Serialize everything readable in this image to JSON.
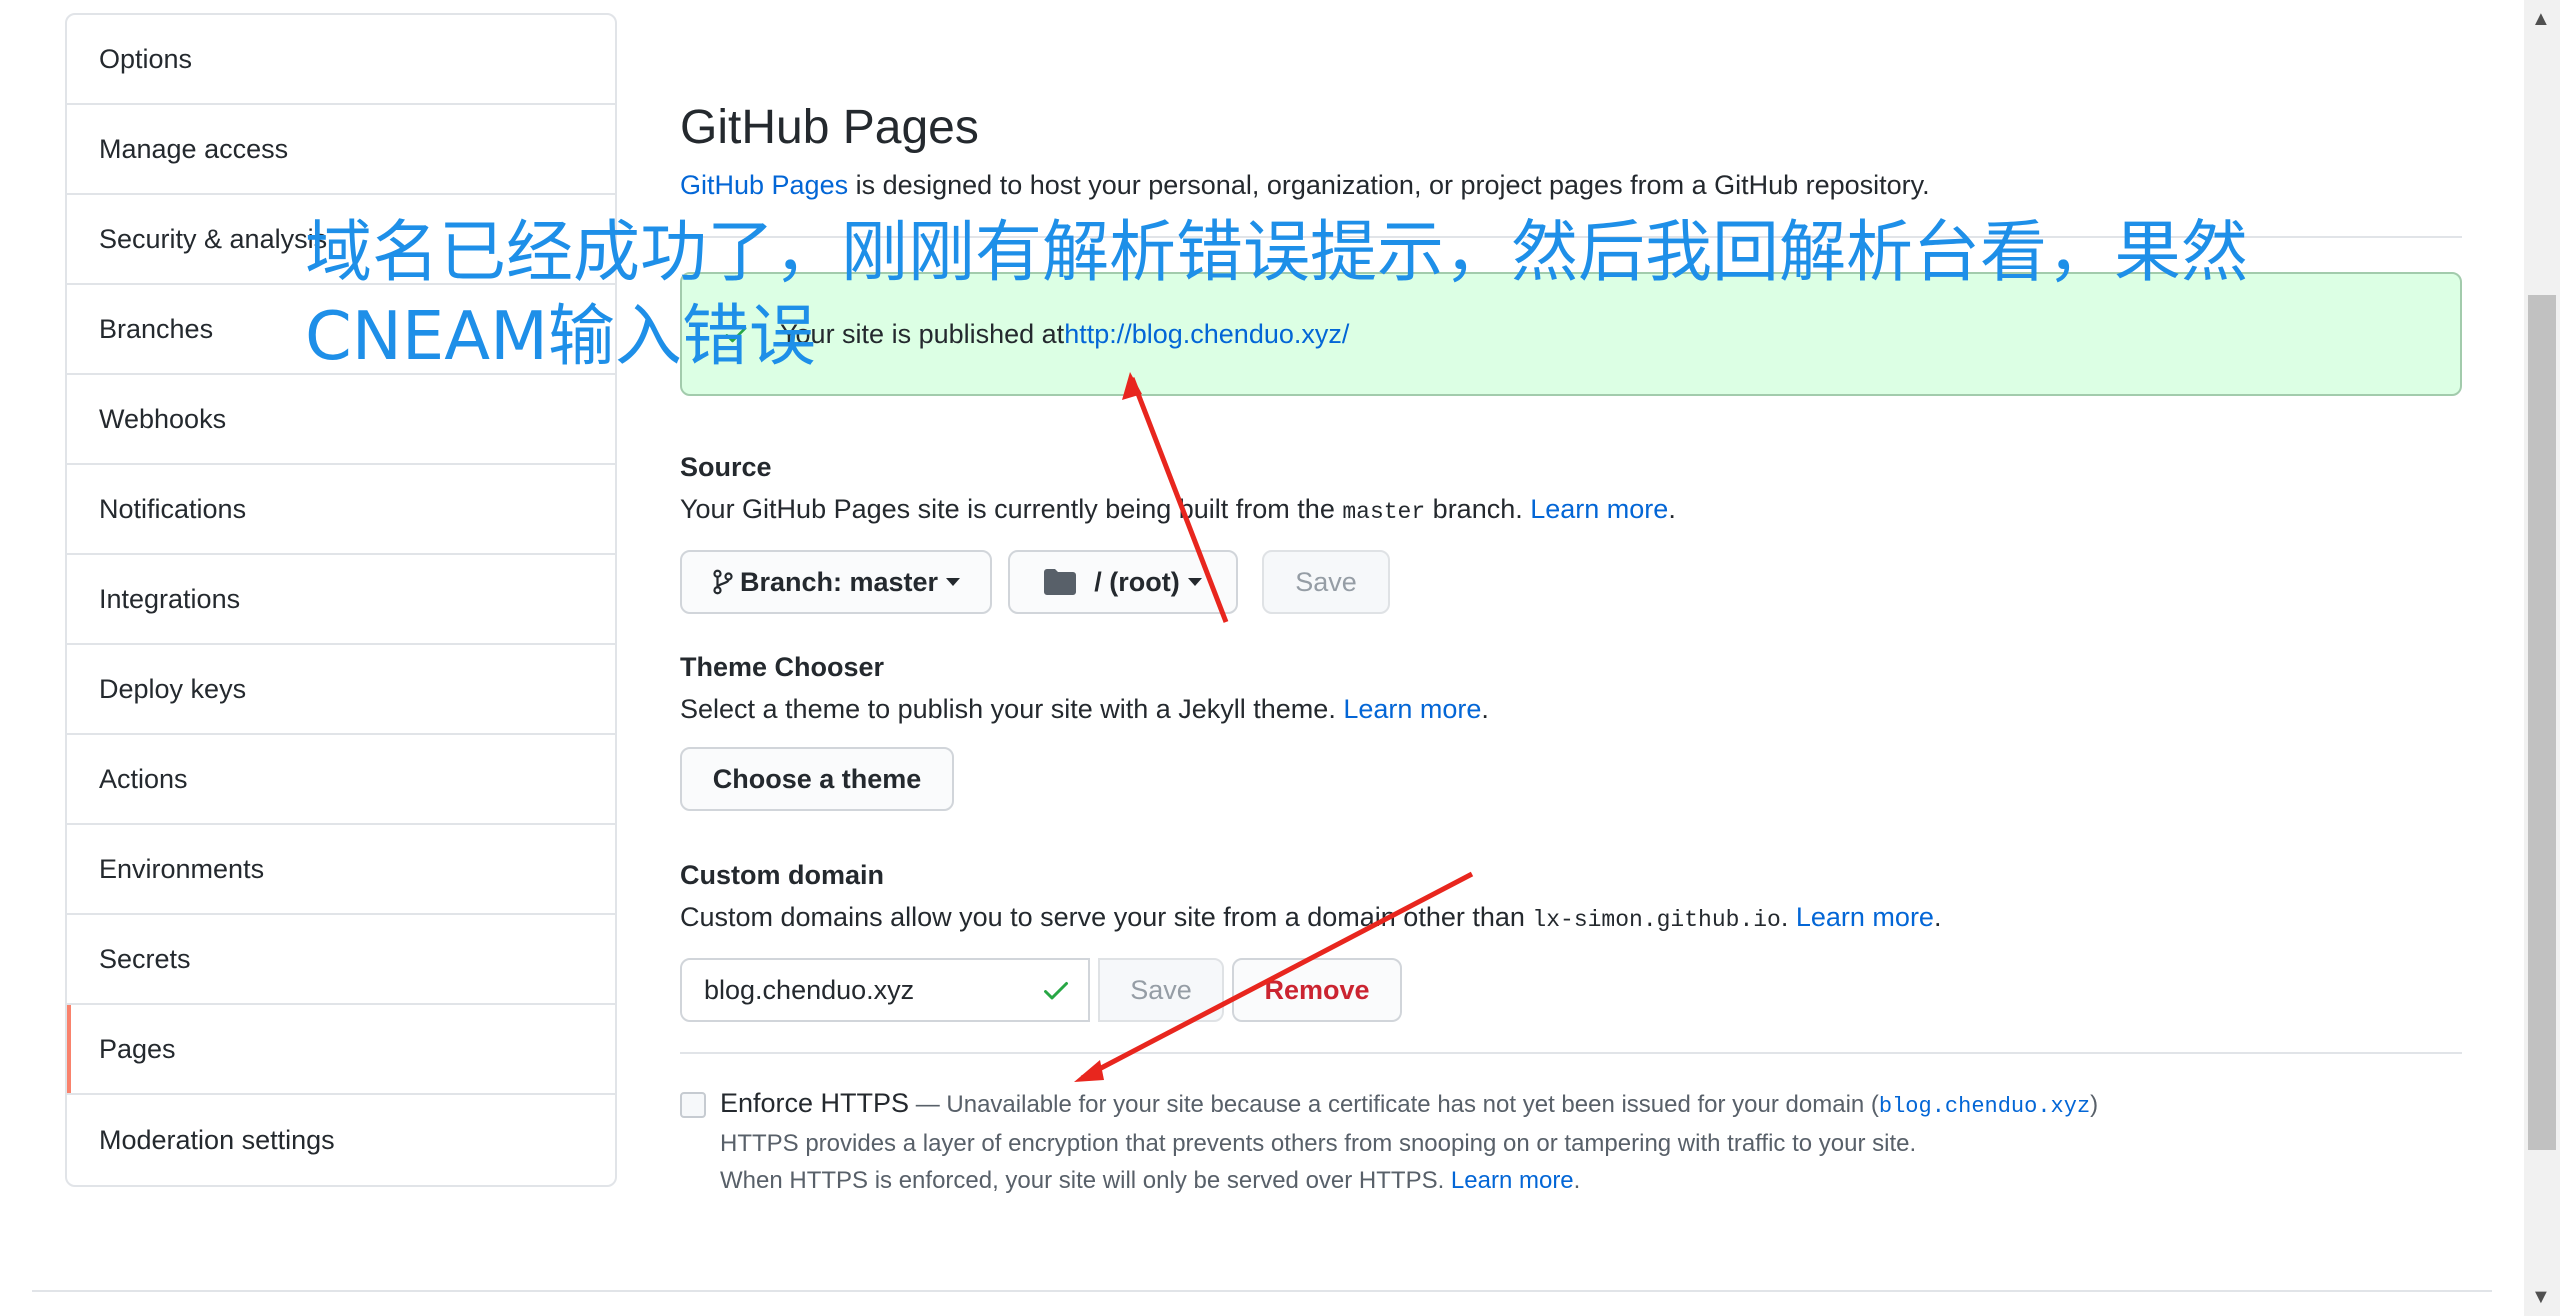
{
  "sidebar": {
    "items": [
      {
        "label": "Options"
      },
      {
        "label": "Manage access"
      },
      {
        "label": "Security & analysis"
      },
      {
        "label": "Branches"
      },
      {
        "label": "Webhooks"
      },
      {
        "label": "Notifications"
      },
      {
        "label": "Integrations"
      },
      {
        "label": "Deploy keys"
      },
      {
        "label": "Actions"
      },
      {
        "label": "Environments"
      },
      {
        "label": "Secrets"
      },
      {
        "label": "Pages"
      },
      {
        "label": "Moderation settings"
      }
    ],
    "selected": "Pages"
  },
  "pages": {
    "title": "GitHub Pages",
    "intro_link": "GitHub Pages",
    "intro_text": " is designed to host your personal, organization, or project pages from a GitHub repository.",
    "flash": {
      "text": "Your site is published at ",
      "url": "http://blog.chenduo.xyz/"
    },
    "source": {
      "heading": "Source",
      "desc_pre": "Your GitHub Pages site is currently being built from the ",
      "branch_code": "master",
      "desc_post": " branch. ",
      "learn_more": "Learn more",
      "period": ".",
      "branch_button": "Branch: master",
      "folder_button": "/ (root)",
      "save_button": "Save"
    },
    "theme": {
      "heading": "Theme Chooser",
      "desc": "Select a theme to publish your site with a Jekyll theme. ",
      "learn_more": "Learn more",
      "period": ".",
      "button": "Choose a theme"
    },
    "custom_domain": {
      "heading": "Custom domain",
      "desc_pre": "Custom domains allow you to serve your site from a domain other than ",
      "domain_code": "lx-simon.github.io",
      "desc_post": ". ",
      "learn_more": "Learn more",
      "period": ".",
      "input_value": "blog.chenduo.xyz",
      "save_button": "Save",
      "remove_button": "Remove"
    },
    "https": {
      "label": "Enforce HTTPS",
      "note_pre": " — Unavailable for your site because a certificate has not yet been issued for your domain (",
      "note_domain": "blog.chenduo.xyz",
      "note_post": ")",
      "line2": "HTTPS provides a layer of encryption that prevents others from snooping on or tampering with traffic to your site.",
      "line3": "When HTTPS is enforced, your site will only be served over HTTPS. ",
      "learn_more": "Learn more",
      "period": "."
    }
  },
  "annotation": {
    "text": "域名已经成功了，刚刚有解析错误提示，然后我回解析台看，果然CNEAM输入错误",
    "color": "#1e8fe8",
    "arrow_color": "#e8261e"
  },
  "colors": {
    "link": "#0366d6",
    "success_bg": "#dcffe4",
    "success_icon": "#28a745",
    "danger": "#cb2431",
    "selected_marker": "#f9826c"
  },
  "icons": {
    "flash": "check-icon",
    "branch": "git-branch-icon",
    "folder": "folder-icon",
    "input_valid": "check-icon"
  }
}
